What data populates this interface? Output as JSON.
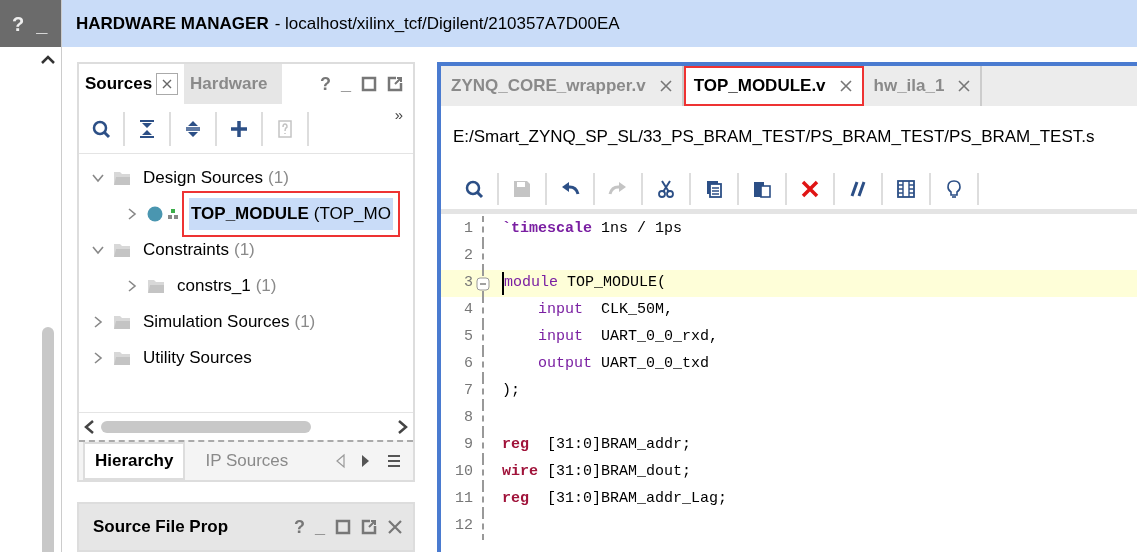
{
  "left_rail": {
    "buttons": [
      "?",
      "_"
    ]
  },
  "header": {
    "title": "HARDWARE MANAGER",
    "subtitle": "- localhost/xilinx_tcf/Digilent/210357A7D00EA"
  },
  "sources_panel": {
    "tabs": [
      {
        "label": "Sources",
        "selected": true,
        "closable": true
      },
      {
        "label": "Hardware",
        "selected": false,
        "closable": false
      }
    ],
    "controls": [
      "?",
      "_"
    ],
    "more": "»",
    "toolbar": [
      {
        "kind": "search",
        "disabled": false
      },
      {
        "kind": "collapse",
        "disabled": false
      },
      {
        "kind": "expand",
        "disabled": false
      },
      {
        "kind": "add",
        "disabled": false
      },
      {
        "kind": "help",
        "disabled": true
      }
    ],
    "tree": [
      {
        "label": "Design Sources",
        "count": "(1)",
        "kind": "folder",
        "expanded": true,
        "selected": false,
        "annotated": false,
        "children": [
          {
            "label": "TOP_MODULE",
            "count": "(TOP_MO",
            "kind": "module",
            "expanded": false,
            "selected": true,
            "annotated": true
          }
        ]
      },
      {
        "label": "Constraints",
        "count": "(1)",
        "kind": "folder",
        "expanded": true,
        "selected": false,
        "annotated": false,
        "children": [
          {
            "label": "constrs_1",
            "count": "(1)",
            "kind": "folder",
            "expanded": false,
            "selected": false,
            "annotated": false
          }
        ]
      },
      {
        "label": "Simulation Sources",
        "count": "(1)",
        "kind": "folder",
        "expanded": false,
        "selected": false,
        "annotated": false
      },
      {
        "label": "Utility Sources",
        "kind": "folder",
        "expanded": false,
        "selected": false,
        "annotated": false
      }
    ],
    "bottom_tabs": [
      {
        "label": "Hierarchy",
        "selected": true
      },
      {
        "label": "IP Sources",
        "selected": false
      }
    ]
  },
  "properties_panel": {
    "title": "Source File Prop",
    "controls": [
      "?",
      "_"
    ]
  },
  "editor": {
    "tabs": [
      {
        "label": "ZYNQ_CORE_wrapper.v",
        "selected": false,
        "annotated": false
      },
      {
        "label": "TOP_MODULE.v",
        "selected": true,
        "annotated": true
      },
      {
        "label": "hw_ila_1",
        "selected": false,
        "annotated": false
      }
    ],
    "path": "E:/Smart_ZYNQ_SP_SL/33_PS_BRAM_TEST/PS_BRAM_TEST/PS_BRAM_TEST.s",
    "toolbar": [
      {
        "kind": "search",
        "disabled": false
      },
      {
        "kind": "save",
        "disabled": true
      },
      {
        "kind": "undo",
        "disabled": false
      },
      {
        "kind": "redo",
        "disabled": true
      },
      {
        "kind": "cut",
        "disabled": false
      },
      {
        "kind": "copy",
        "disabled": false
      },
      {
        "kind": "paste",
        "disabled": false
      },
      {
        "kind": "delete",
        "disabled": false
      },
      {
        "kind": "comment",
        "disabled": false
      },
      {
        "kind": "columns",
        "disabled": false
      },
      {
        "kind": "hint",
        "disabled": false
      }
    ],
    "lines": [
      {
        "number": "1",
        "current": false,
        "foldable": false,
        "tokens": [
          {
            "text": "`timescale",
            "kind": "directive"
          },
          {
            "text": " 1ns / 1ps",
            "kind": "plain"
          }
        ]
      },
      {
        "number": "2",
        "current": false,
        "foldable": false
      },
      {
        "number": "3",
        "current": true,
        "foldable": true,
        "tokens": [
          {
            "text": "module",
            "kind": "port"
          },
          {
            "text": " TOP_MODULE(",
            "kind": "plain"
          }
        ]
      },
      {
        "number": "4",
        "current": false,
        "foldable": false,
        "tokens": [
          {
            "text": "    input",
            "kind": "port"
          },
          {
            "text": "  CLK_50M,",
            "kind": "plain"
          }
        ]
      },
      {
        "number": "5",
        "current": false,
        "foldable": false,
        "tokens": [
          {
            "text": "    input",
            "kind": "port"
          },
          {
            "text": "  UART_0_0_rxd,",
            "kind": "plain"
          }
        ]
      },
      {
        "number": "6",
        "current": false,
        "foldable": false,
        "tokens": [
          {
            "text": "    output",
            "kind": "port"
          },
          {
            "text": " UART_0_0_txd",
            "kind": "plain"
          }
        ]
      },
      {
        "number": "7",
        "current": false,
        "foldable": false,
        "tokens": [
          {
            "text": ");",
            "kind": "plain"
          }
        ]
      },
      {
        "number": "8",
        "current": false,
        "foldable": false
      },
      {
        "number": "9",
        "current": false,
        "foldable": false,
        "tokens": [
          {
            "text": "reg",
            "kind": "type"
          },
          {
            "text": "  [31:0]BRAM_addr;",
            "kind": "plain"
          }
        ]
      },
      {
        "number": "10",
        "current": false,
        "foldable": false,
        "tokens": [
          {
            "text": "wire",
            "kind": "type"
          },
          {
            "text": " [31:0]BRAM_dout;",
            "kind": "plain"
          }
        ]
      },
      {
        "number": "11",
        "current": false,
        "foldable": false,
        "tokens": [
          {
            "text": "reg",
            "kind": "type"
          },
          {
            "text": "  [31:0]BRAM_addr_Lag;",
            "kind": "plain"
          }
        ]
      },
      {
        "number": "12",
        "current": false,
        "foldable": false
      }
    ]
  }
}
